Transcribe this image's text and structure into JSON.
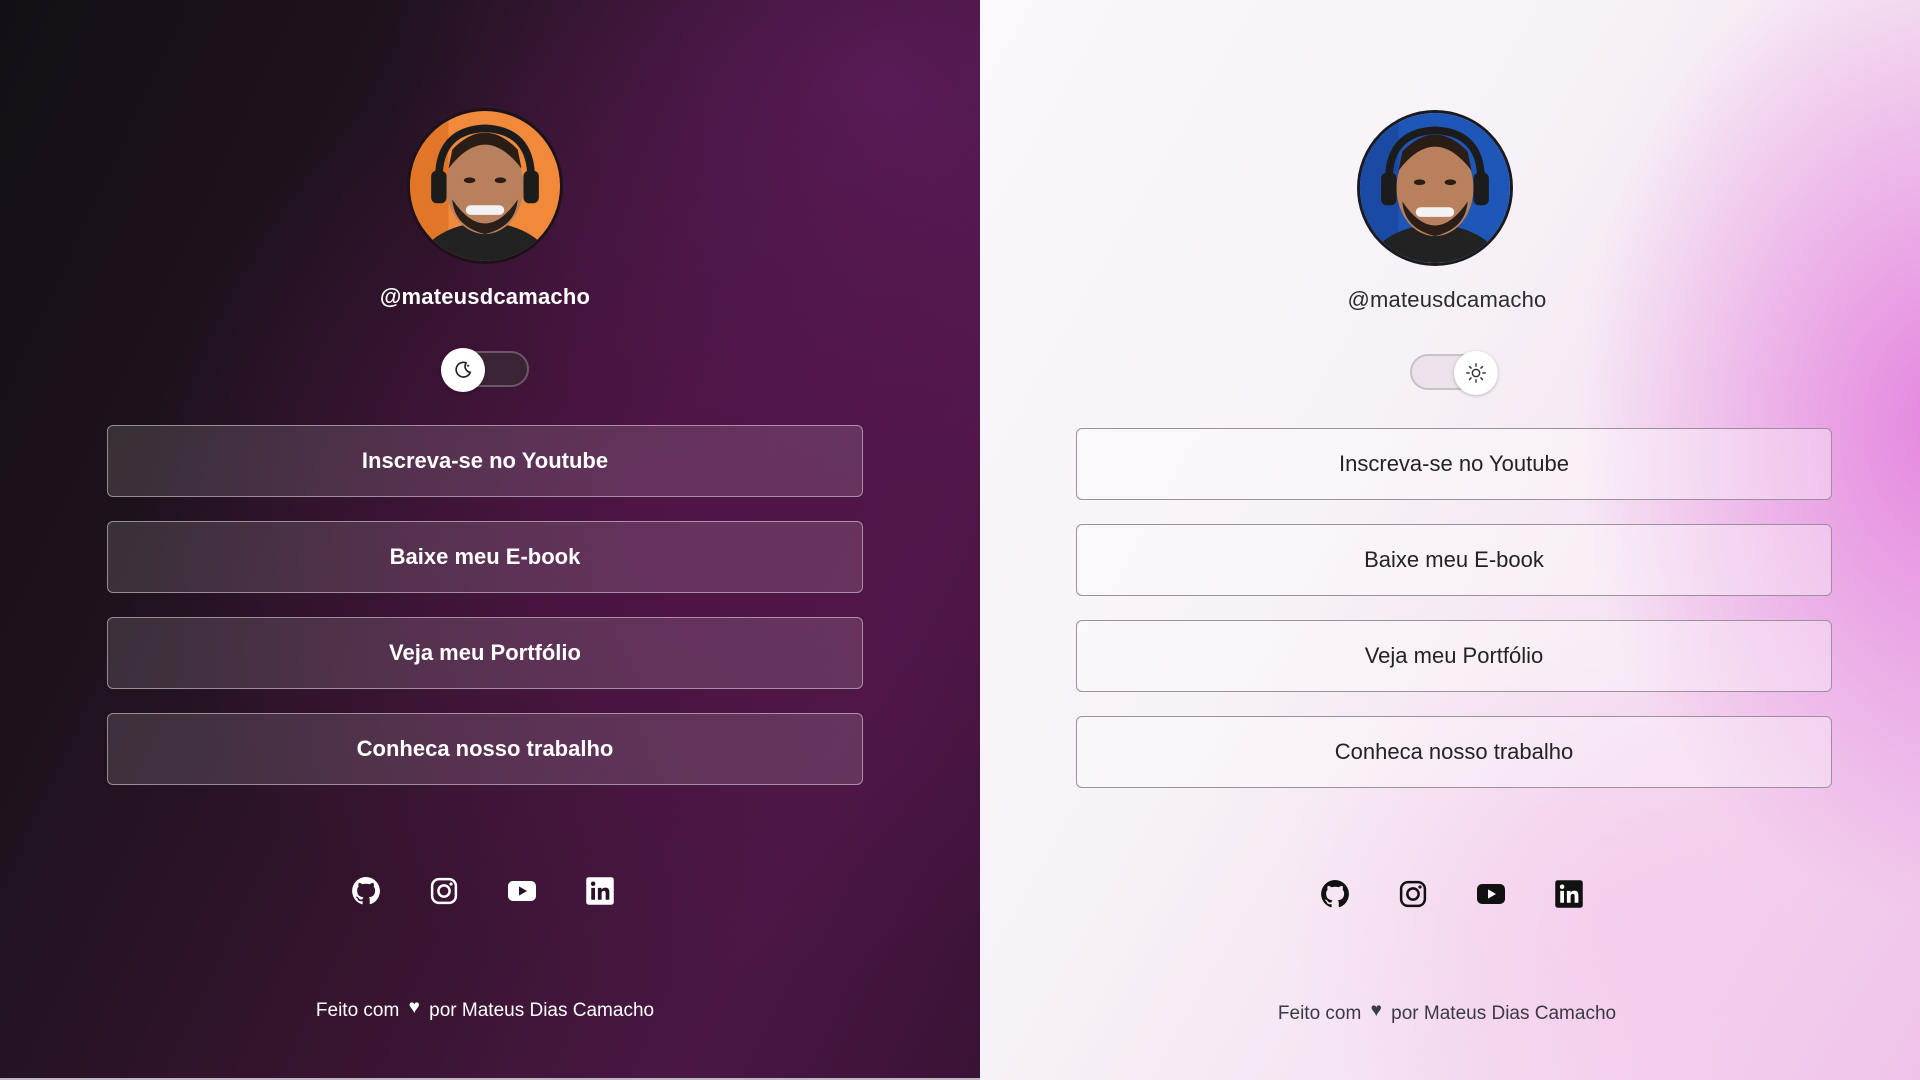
{
  "colors": {
    "dark_accent": "#4a1744",
    "light_accent": "#efc2ea",
    "dark_text": "#ffffff",
    "light_text": "#222228"
  },
  "dark_panel": {
    "theme": "dark",
    "handle": "@mateusdcamacho",
    "toggle_icon": "moon-icon",
    "links": [
      {
        "label": "Inscreva-se no Youtube"
      },
      {
        "label": "Baixe meu E-book"
      },
      {
        "label": "Veja meu Portfólio"
      },
      {
        "label": "Conheca nosso trabalho"
      }
    ],
    "socials": [
      "github-icon",
      "instagram-icon",
      "youtube-icon",
      "linkedin-icon"
    ],
    "footer": {
      "prefix": "Feito com",
      "heart": "♥",
      "suffix": "por Mateus Dias Camacho"
    }
  },
  "light_panel": {
    "theme": "light",
    "handle": "@mateusdcamacho",
    "toggle_icon": "sun-icon",
    "links": [
      {
        "label": "Inscreva-se no Youtube"
      },
      {
        "label": "Baixe meu E-book"
      },
      {
        "label": "Veja meu Portfólio"
      },
      {
        "label": "Conheca nosso trabalho"
      }
    ],
    "socials": [
      "github-icon",
      "instagram-icon",
      "youtube-icon",
      "linkedin-icon"
    ],
    "footer": {
      "prefix": "Feito com",
      "heart": "♥",
      "suffix": "por Mateus Dias Camacho"
    }
  }
}
